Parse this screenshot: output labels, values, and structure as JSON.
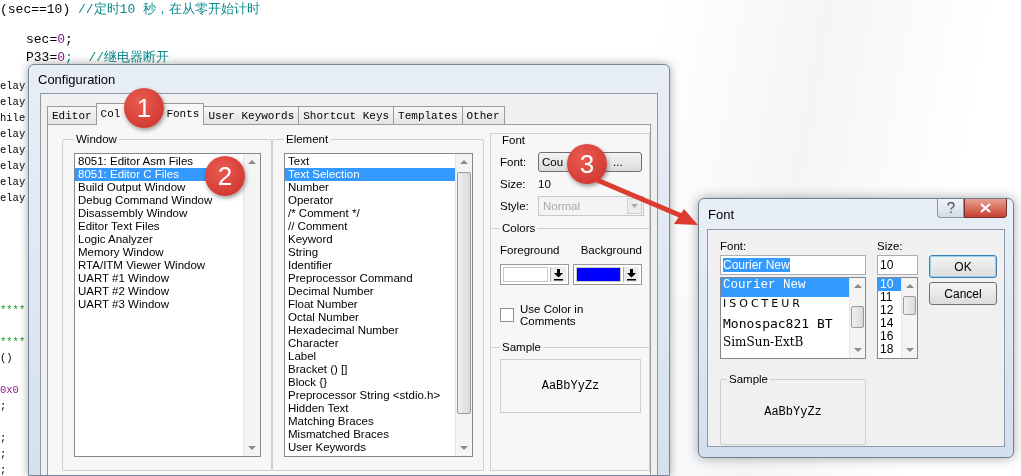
{
  "editor": {
    "lines": [
      {
        "kind": "code",
        "segments": [
          {
            "text": "(sec==10)",
            "kind": "plain"
          },
          {
            "text": " //定时10 秒，在从零开始计时",
            "kind": "comment"
          }
        ]
      },
      {
        "kind": "blank"
      },
      {
        "kind": "indented",
        "segments": [
          {
            "text": "sec=",
            "kind": "plain"
          },
          {
            "text": "0",
            "kind": "number"
          },
          {
            "text": ";",
            "kind": "plain"
          }
        ]
      },
      {
        "kind": "indented",
        "segments": [
          {
            "text": "P33=",
            "kind": "plain"
          },
          {
            "text": "0",
            "kind": "number"
          },
          {
            "text": ";  //继电器断开",
            "kind": "comment"
          }
        ]
      },
      {
        "kind": "blank"
      },
      {
        "kind": "edge",
        "segments": [
          {
            "text": "elay",
            "kind": "plain"
          }
        ]
      },
      {
        "kind": "edge",
        "segments": [
          {
            "text": "elay",
            "kind": "plain"
          }
        ]
      },
      {
        "kind": "edge",
        "segments": [
          {
            "text": "hile",
            "kind": "plain"
          }
        ]
      },
      {
        "kind": "edge",
        "segments": [
          {
            "text": "elay",
            "kind": "plain"
          }
        ]
      },
      {
        "kind": "edge",
        "segments": [
          {
            "text": "elay",
            "kind": "plain"
          }
        ]
      },
      {
        "kind": "edge",
        "segments": [
          {
            "text": "elay",
            "kind": "plain"
          }
        ]
      },
      {
        "kind": "edge",
        "segments": [
          {
            "text": "elay",
            "kind": "plain"
          }
        ]
      },
      {
        "kind": "edge",
        "segments": [
          {
            "text": "elay",
            "kind": "plain"
          }
        ]
      },
      {
        "kind": "blank"
      },
      {
        "kind": "blank"
      },
      {
        "kind": "blank"
      },
      {
        "kind": "blank"
      },
      {
        "kind": "blank"
      },
      {
        "kind": "blank"
      },
      {
        "kind": "edge",
        "segments": [
          {
            "text": "****",
            "kind": "banner"
          }
        ]
      },
      {
        "kind": "blank"
      },
      {
        "kind": "edge",
        "segments": [
          {
            "text": "****",
            "kind": "banner"
          }
        ]
      },
      {
        "kind": "edge",
        "segments": [
          {
            "text": "()",
            "kind": "plain"
          }
        ]
      },
      {
        "kind": "blank"
      },
      {
        "kind": "edge",
        "segments": [
          {
            "text": "0x0",
            "kind": "number"
          }
        ]
      },
      {
        "kind": "edge",
        "segments": [
          {
            "text": ";",
            "kind": "plain"
          }
        ]
      },
      {
        "kind": "blank"
      },
      {
        "kind": "edge",
        "segments": [
          {
            "text": ";",
            "kind": "plain"
          }
        ]
      },
      {
        "kind": "edge",
        "segments": [
          {
            "text": ";",
            "kind": "plain"
          }
        ]
      },
      {
        "kind": "edge",
        "segments": [
          {
            "text": ";",
            "kind": "plain"
          }
        ]
      }
    ]
  },
  "config": {
    "title": "Configuration",
    "tabs": [
      {
        "label": [
          "Editor"
        ],
        "selected": false
      },
      {
        "label": [
          "Col",
          "Fonts"
        ],
        "selected": true
      },
      {
        "label": [
          "User Keywords"
        ],
        "selected": false
      },
      {
        "label": [
          "Shortcut Keys"
        ],
        "selected": false
      },
      {
        "label": [
          "Templates"
        ],
        "selected": false
      },
      {
        "label": [
          "Other"
        ],
        "selected": false
      }
    ],
    "window_group": {
      "title": "Window",
      "items": [
        {
          "label": "8051: Editor Asm Files",
          "selected": false
        },
        {
          "label": "8051: Editor C Files",
          "selected": true
        },
        {
          "label": "Build Output Window",
          "selected": false
        },
        {
          "label": "Debug Command Window",
          "selected": false
        },
        {
          "label": "Disassembly Window",
          "selected": false
        },
        {
          "label": "Editor Text Files",
          "selected": false
        },
        {
          "label": "Logic Analyzer",
          "selected": false
        },
        {
          "label": "Memory Window",
          "selected": false
        },
        {
          "label": "RTA/ITM Viewer Window",
          "selected": false
        },
        {
          "label": "UART #1 Window",
          "selected": false
        },
        {
          "label": "UART #2 Window",
          "selected": false
        },
        {
          "label": "UART #3 Window",
          "selected": false
        }
      ]
    },
    "element_group": {
      "title": "Element",
      "items": [
        {
          "label": "Text",
          "selected": false
        },
        {
          "label": "Text Selection",
          "selected": true
        },
        {
          "label": "Number",
          "selected": false
        },
        {
          "label": "Operator",
          "selected": false
        },
        {
          "label": "/* Comment */",
          "selected": false
        },
        {
          "label": "// Comment",
          "selected": false
        },
        {
          "label": "Keyword",
          "selected": false
        },
        {
          "label": "String",
          "selected": false
        },
        {
          "label": "Identifier",
          "selected": false
        },
        {
          "label": "Preprocessor Command",
          "selected": false
        },
        {
          "label": "Decimal Number",
          "selected": false
        },
        {
          "label": "Float Number",
          "selected": false
        },
        {
          "label": "Octal Number",
          "selected": false
        },
        {
          "label": "Hexadecimal Number",
          "selected": false
        },
        {
          "label": "Character",
          "selected": false
        },
        {
          "label": "Label",
          "selected": false
        },
        {
          "label": "Bracket () []",
          "selected": false
        },
        {
          "label": "Block {}",
          "selected": false
        },
        {
          "label": "Preprocessor String <stdio.h>",
          "selected": false
        },
        {
          "label": "Hidden Text",
          "selected": false
        },
        {
          "label": "Matching Braces",
          "selected": false
        },
        {
          "label": "Mismatched Braces",
          "selected": false
        },
        {
          "label": "User Keywords",
          "selected": false
        }
      ]
    },
    "font_group": {
      "title": "Font",
      "font_label": "Font:",
      "font_button": [
        "Cou",
        "..."
      ],
      "size_label": "Size:",
      "size_value": "10",
      "style_label": "Style:",
      "style_value": "Normal",
      "style_disabled": true
    },
    "colors_group": {
      "title": "Colors",
      "pickers": [
        {
          "label": "Foreground",
          "color": "#ffffff"
        },
        {
          "label": "Background",
          "color": "#0000ff"
        }
      ],
      "checkbox": {
        "label": "Use Color in Comments",
        "checked": false
      }
    },
    "sample_group": {
      "title": "Sample",
      "text": "AaBbYyZz"
    }
  },
  "font_dialog": {
    "title": "Font",
    "font_label": "Font:",
    "font_value": "Courier New",
    "fonts": [
      {
        "label": "Courier New",
        "kind": "mono",
        "selected": true
      },
      {
        "label": "ISOCTEUR",
        "kind": "spaced",
        "selected": false
      },
      {
        "label": "Monospac821 BT",
        "kind": "wide",
        "selected": false
      },
      {
        "label": "SimSun-ExtB",
        "kind": "serif",
        "selected": false
      }
    ],
    "size_label": "Size:",
    "size_value": "10",
    "sizes": [
      {
        "label": "10",
        "selected": true
      },
      {
        "label": "11",
        "selected": false
      },
      {
        "label": "12",
        "selected": false
      },
      {
        "label": "14",
        "selected": false
      },
      {
        "label": "16",
        "selected": false
      },
      {
        "label": "18",
        "selected": false
      }
    ],
    "buttons": [
      "OK",
      "Cancel"
    ],
    "sample_title": "Sample",
    "sample_text": "AaBbYyZz"
  },
  "callouts": [
    "1",
    "2",
    "3"
  ]
}
